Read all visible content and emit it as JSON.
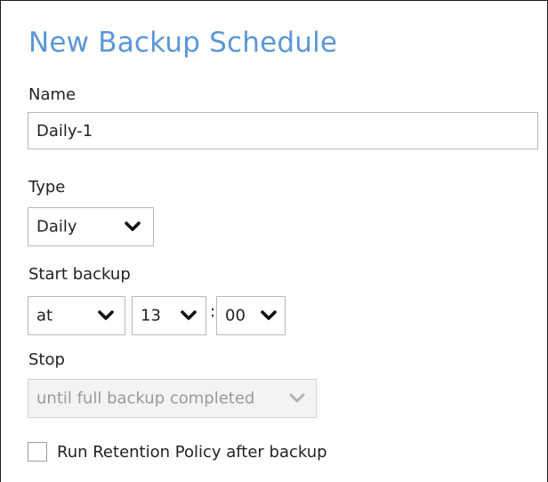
{
  "dialog": {
    "title": "New Backup Schedule"
  },
  "name_field": {
    "label": "Name",
    "value": "Daily-1"
  },
  "type_field": {
    "label": "Type",
    "selected": "Daily"
  },
  "start_backup": {
    "label": "Start backup",
    "mode": "at",
    "hour": "13",
    "separator": ":",
    "minute": "00"
  },
  "stop_field": {
    "label": "Stop",
    "selected": "until full backup completed",
    "disabled": true
  },
  "retention": {
    "label": "Run Retention Policy after backup",
    "checked": false
  },
  "colors": {
    "title": "#5b97d6",
    "border": "#b9b9b9",
    "disabled_text": "#9a9a9a"
  },
  "icons": {
    "dropdown": "chevron-down-icon"
  }
}
